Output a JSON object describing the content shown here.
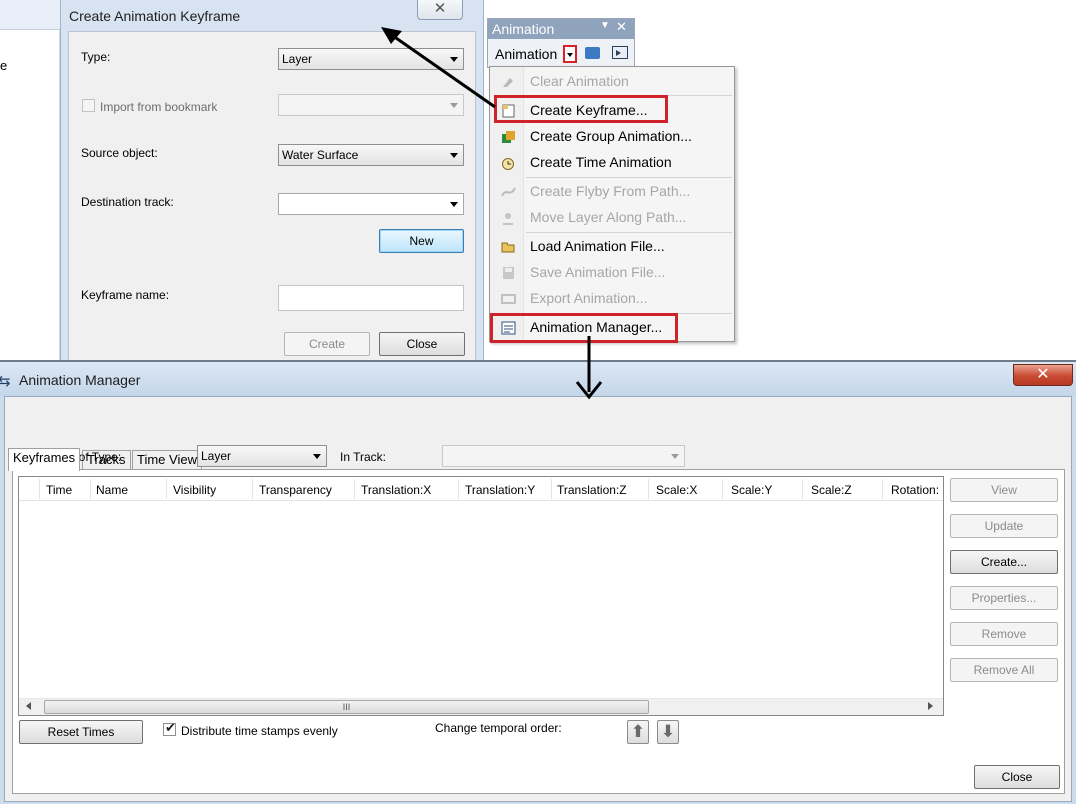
{
  "bg_window": {
    "fragment": "e"
  },
  "create_keyframe": {
    "title": "Create Animation Keyframe",
    "close_glyph": "✕",
    "type_label": "Type:",
    "type_value": "Layer",
    "import_label": "Import from bookmark",
    "import_checked": false,
    "source_label": "Source object:",
    "source_value": "Water Surface",
    "destination_label": "Destination track:",
    "destination_value": "",
    "new_button": "New",
    "keyframe_name_label": "Keyframe name:",
    "keyframe_name_value": "",
    "create_button": "Create",
    "close_button": "Close"
  },
  "animation_toolbar": {
    "title": "Animation",
    "dropdown_label": "Animation",
    "icons": [
      "camera-capture-icon",
      "animation-controls-icon"
    ]
  },
  "animation_menu": {
    "items": [
      {
        "label": "Clear Animation",
        "enabled": false,
        "icon": "clear-animation-icon"
      },
      {
        "label": "Create Keyframe...",
        "enabled": true,
        "icon": "create-keyframe-icon",
        "highlighted": true
      },
      {
        "label": "Create Group Animation...",
        "enabled": true,
        "icon": "group-animation-icon"
      },
      {
        "label": "Create Time Animation",
        "enabled": true,
        "icon": "time-animation-icon"
      },
      {
        "label": "Create Flyby From Path...",
        "enabled": false,
        "icon": "flyby-path-icon"
      },
      {
        "label": "Move Layer Along Path...",
        "enabled": false,
        "icon": "move-layer-path-icon"
      },
      {
        "label": "Load Animation File...",
        "enabled": true,
        "icon": "open-folder-icon"
      },
      {
        "label": "Save Animation File...",
        "enabled": false,
        "icon": "save-disk-icon"
      },
      {
        "label": "Export Animation...",
        "enabled": false,
        "icon": "export-film-icon"
      },
      {
        "label": "Animation Manager...",
        "enabled": true,
        "icon": "animation-manager-icon",
        "highlighted": true
      }
    ]
  },
  "animation_manager": {
    "title": "Animation Manager",
    "close_glyph": "✕",
    "tabs": [
      "Keyframes",
      "Tracks",
      "Time View"
    ],
    "active_tab": "Keyframes",
    "keyframes_of_type_label": "Keyframes of Type:",
    "keyframes_of_type_value": "Layer",
    "in_track_label": "In Track:",
    "in_track_value": "",
    "columns": [
      "Time",
      "Name",
      "Visibility",
      "Transparency",
      "Translation:X",
      "Translation:Y",
      "Translation:Z",
      "Scale:X",
      "Scale:Y",
      "Scale:Z",
      "Rotation:"
    ],
    "rows": [],
    "scroll_grip": "III",
    "side_buttons": [
      {
        "label": "View",
        "enabled": false
      },
      {
        "label": "Update",
        "enabled": false
      },
      {
        "label": "Create...",
        "enabled": true
      },
      {
        "label": "Properties...",
        "enabled": false
      },
      {
        "label": "Remove",
        "enabled": false
      },
      {
        "label": "Remove All",
        "enabled": false
      }
    ],
    "reset_times_button": "Reset Times",
    "distribute_label": "Distribute time stamps evenly",
    "distribute_checked": true,
    "temporal_order_label": "Change temporal order:",
    "move_up_glyph": "⬆",
    "move_down_glyph": "⬇",
    "close_button": "Close"
  },
  "colors": {
    "highlight_box": "#d0222b",
    "window_frame": "#cddcec",
    "menu_background": "#f5f5f5"
  }
}
